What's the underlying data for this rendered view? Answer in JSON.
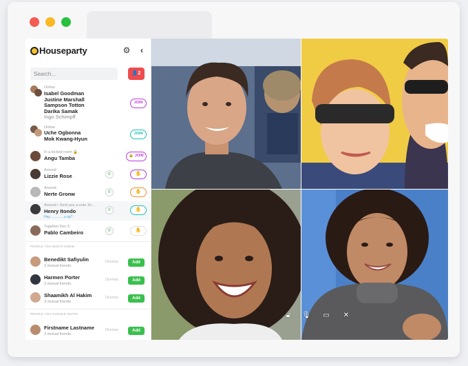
{
  "app": {
    "name": "Houseparty",
    "search_placeholder": "Search...",
    "friend_request_count": "2",
    "icons": {
      "settings": "gear-icon",
      "back": "chevron-left-icon",
      "add_friend": "user-plus-icon"
    }
  },
  "rooms": [
    {
      "status": "Online",
      "names": [
        "Isabel Goodman",
        "Justine Marshall",
        "Sampson Totton",
        "Darika Samak"
      ],
      "muted_name": "Ingo Schimpff",
      "action": "JOIN",
      "action_color": "#c03ae0"
    },
    {
      "status": "Online",
      "names": [
        "Uche Ogbonna",
        "Mok Kwang-Hyun"
      ],
      "action": "JOIN",
      "action_color": "#1bc0b6"
    },
    {
      "status": "In a locked room",
      "names": [
        "Angu Tamba"
      ],
      "action": "JOIN",
      "action_color": "#c03ae0"
    }
  ],
  "friends": [
    {
      "status": "Around",
      "name": "Lizzie Rose",
      "wave_color": "#b03ad8"
    },
    {
      "status": "Around",
      "name": "Nerte Gronw",
      "wave_color": "#f08b2b"
    },
    {
      "status": "Around • Sent you a note 1h…",
      "name": "Henry Itondo",
      "message": "Hey…………u up?",
      "wave_color": "#1bc0b6"
    },
    {
      "status": "Together Dec 5",
      "name": "Pablo Cambeiro",
      "wave_color": "#e0e0e0"
    }
  ],
  "suggestions": {
    "section_title": "PEOPLE YOU MIGHT KNOW",
    "dismiss_label": "Dismiss",
    "add_label": "Add",
    "items": [
      {
        "name": "Benedikt Safiyulin",
        "sub": "3 mutual friends"
      },
      {
        "name": "Harmen Porter",
        "sub": "3 mutual friends"
      },
      {
        "name": "Shaamikh Al Hakim",
        "sub": "3 mutual friends"
      }
    ]
  },
  "invites": {
    "section_title": "PEOPLE YOU SHOULD INVITE",
    "items": [
      {
        "name": "Firstname Lastname",
        "sub": "3 mutual friends"
      }
    ]
  },
  "video_controls": [
    "lock-icon",
    "microphone-icon",
    "screen-share-icon",
    "close-icon"
  ]
}
